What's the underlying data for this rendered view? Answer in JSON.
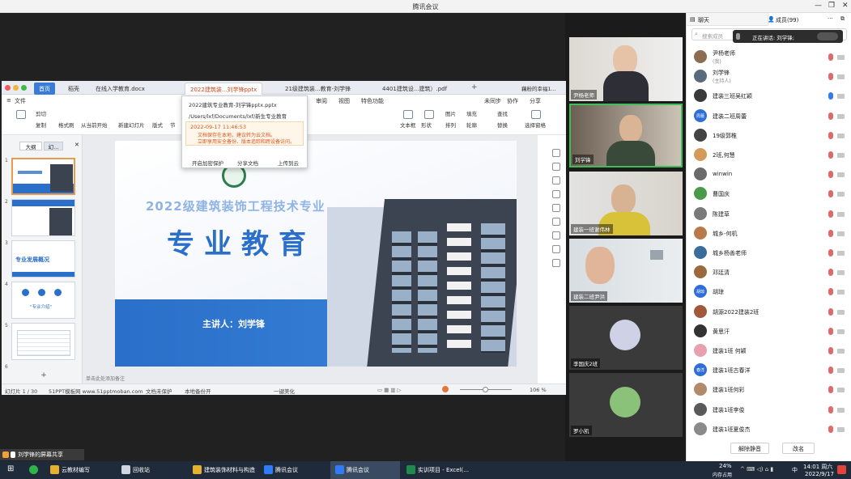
{
  "window": {
    "title": "腾讯会议"
  },
  "wps": {
    "tabs": [
      "首页",
      "稻壳",
      "在线入学教育.docx",
      "2022建筑装...刘学锋pptx",
      "21级建筑装...教育-刘学锋",
      "4401建筑设...建筑）.pdf"
    ],
    "account": "藕粉的幸福1...",
    "menu": [
      "文件",
      "审阅",
      "视图",
      "特色功能",
      "未同步",
      "协作",
      "分享"
    ],
    "ribbon": [
      "剪切",
      "复制",
      "格式刷",
      "从当前开始",
      "新建幻灯片",
      "版式",
      "节",
      "文本框",
      "形状",
      "排列",
      "轮廓",
      "替换",
      "选择窗格",
      "图片",
      "填充",
      "查找"
    ],
    "panel_tabs": [
      "大纲",
      "幻..."
    ],
    "thumb_numbers": [
      "1",
      "2",
      "3",
      "4",
      "5",
      "6"
    ],
    "thumb_texts": {
      "t3": "专业发展概况",
      "t4": "\"专业介绍\""
    },
    "notes": "单击此处添加备注",
    "status": {
      "slide": "幻灯片 1 / 30",
      "template": "51PPT模板网  www.51pptmoban.com",
      "doc_protect": "文档未保护",
      "backup": "本地备份开",
      "beautify": "一键美化",
      "zoom": "106 %"
    }
  },
  "slide": {
    "title_small": "2022级建筑装饰工程技术专业",
    "title_big": "专业教育",
    "presenter": "主讲人：刘学锋"
  },
  "popup": {
    "file": "2022建筑专业教育-刘学锋pptx.pptx",
    "path": "/Users/lxf/Documents/lxf/新生专业教育",
    "time": "2022-09-17 11:46:53",
    "warning1": "文档保存在本地，建议转为云文档。",
    "warning2": "立即享用安全备份、版本追踪和跨设备访问。",
    "btn_protect": "开启加密保护",
    "btn_share": "分享文档",
    "btn_upload": "上传到云"
  },
  "videos": [
    {
      "label": "尹杨老师"
    },
    {
      "label": "刘学锋"
    },
    {
      "label": "建装一班谢伟林"
    },
    {
      "label": "建装二班尹洪"
    },
    {
      "label": "李国庆2班"
    },
    {
      "label": "罗小凯"
    }
  ],
  "share_bar": {
    "text": "刘学锋的屏幕共享"
  },
  "panel": {
    "tab_chat": "聊天",
    "tab_members": "成员(99)",
    "more": "···",
    "search_placeholder": "搜索成员",
    "speaking": "正在讲话: 刘学锋;",
    "members": [
      {
        "name": "尹杨老师",
        "role": "(我)",
        "color": "#8c6d52"
      },
      {
        "name": "刘学锋",
        "role": "(主持人)",
        "color": "#5a6b7c"
      },
      {
        "name": "建装三班吴红颖",
        "role": "",
        "color": "#3a3a3a"
      },
      {
        "name": "建装二班周蕾",
        "role": "",
        "color": "#2f6ed8",
        "badge": "周蕾"
      },
      {
        "name": "19级郭椎",
        "role": "",
        "color": "#444"
      },
      {
        "name": "2班,何慧",
        "role": "",
        "color": "#d39a5a"
      },
      {
        "name": "winwin",
        "role": "",
        "color": "#6b6b6b"
      },
      {
        "name": "曹国庆",
        "role": "",
        "color": "#4a9a4a"
      },
      {
        "name": "陈建草",
        "role": "",
        "color": "#7a7a7a"
      },
      {
        "name": "城乡-何机",
        "role": "",
        "color": "#b87a4a"
      },
      {
        "name": "城乡杨善老师",
        "role": "",
        "color": "#3a6e9a"
      },
      {
        "name": "邓廷清",
        "role": "",
        "color": "#9a6a3a"
      },
      {
        "name": "胡琼",
        "role": "",
        "color": "#2f6ed8",
        "badge": "胡琼"
      },
      {
        "name": "胡源2022建装2班",
        "role": "",
        "color": "#a05a3a"
      },
      {
        "name": "黄思汗",
        "role": "",
        "color": "#333"
      },
      {
        "name": "建装1班 何颖",
        "role": "",
        "color": "#e8a0b0"
      },
      {
        "name": "建装1班古春洋",
        "role": "",
        "color": "#2f6ed8",
        "badge": "春洋"
      },
      {
        "name": "建装1班何彩",
        "role": "",
        "color": "#b08a6a"
      },
      {
        "name": "建装1班李俊",
        "role": "",
        "color": "#5a5a5a"
      },
      {
        "name": "建装1班夏俊杰",
        "role": "",
        "color": "#8a8a8a"
      }
    ],
    "btn_mute_all": "解除静音",
    "btn_rename": "改名"
  },
  "taskbar": {
    "items": [
      "云教材编写",
      "回收站",
      "建筑装饰材料与构造",
      "腾讯会议",
      "腾讯会议",
      "实训项目 - Excel(..."
    ],
    "cpu": "24%",
    "cpu_label": "内存占用",
    "time": "14:01 周六",
    "date": "2022/9/17",
    "ime": "中"
  }
}
